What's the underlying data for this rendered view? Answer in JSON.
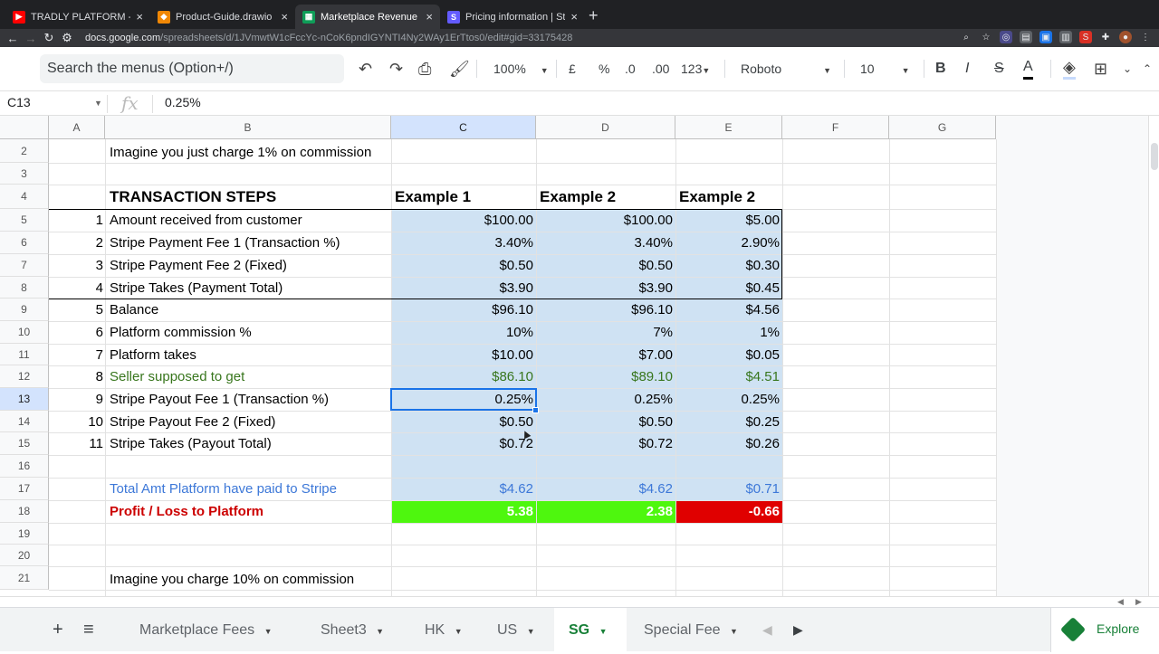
{
  "browser": {
    "tabs": [
      {
        "label": "TRADLY PLATFORM - YouTube",
        "icon": "youtube-icon",
        "color": "#ff0000"
      },
      {
        "label": "Product-Guide.drawio - diagra",
        "icon": "drawio-icon",
        "color": "#f08705"
      },
      {
        "label": "Marketplace Revenue Model C",
        "icon": "sheets-icon",
        "color": "#0f9d58",
        "active": true
      },
      {
        "label": "Pricing information | Stripe Con",
        "icon": "stripe-icon",
        "color": "#635bff"
      }
    ],
    "url_host": "docs.google.com",
    "url_path": "/spreadsheets/d/1JVmwtW1cFccYc-nCoK6pndIGYNTI4Ny2WAy1ErTtos0/edit#gid=33175428"
  },
  "toolbar": {
    "search_placeholder": "Search the menus (Option+/)",
    "zoom": "100%",
    "currency": "£",
    "percent": "%",
    "dec_decrease": ".0",
    "dec_increase": ".00",
    "number_format": "123",
    "font": "Roboto",
    "font_size": "10",
    "bold": "B",
    "italic": "I",
    "strike": "S",
    "text_color": "A"
  },
  "formula_bar": {
    "cell_ref": "C13",
    "fx": "fx",
    "value": "0.25%"
  },
  "columns": [
    "A",
    "B",
    "C",
    "D",
    "E",
    "F",
    "G"
  ],
  "rows": [
    "2",
    "3",
    "4",
    "5",
    "6",
    "7",
    "8",
    "9",
    "10",
    "11",
    "12",
    "13",
    "14",
    "15",
    "16",
    "17",
    "18",
    "19",
    "20",
    "21"
  ],
  "sheet": {
    "r2_text": "Imagine you just charge 1% on commission",
    "r4_title": "TRANSACTION STEPS",
    "r4_c": "Example 1",
    "r4_d": "Example 2",
    "r4_e": "Example 2",
    "steps": [
      {
        "n": "1",
        "label": "Amount received from customer",
        "c": "$100.00",
        "d": "$100.00",
        "e": "$5.00"
      },
      {
        "n": "2",
        "label": "Stripe Payment Fee 1 (Transaction %)",
        "c": "3.40%",
        "d": "3.40%",
        "e": "2.90%"
      },
      {
        "n": "3",
        "label": "Stripe Payment Fee 2 (Fixed)",
        "c": "$0.50",
        "d": "$0.50",
        "e": "$0.30"
      },
      {
        "n": "4",
        "label": "Stripe Takes (Payment Total)",
        "c": "$3.90",
        "d": "$3.90",
        "e": "$0.45"
      },
      {
        "n": "5",
        "label": "Balance",
        "c": "$96.10",
        "d": "$96.10",
        "e": "$4.56"
      },
      {
        "n": "6",
        "label": "Platform commission %",
        "c": "10%",
        "d": "7%",
        "e": "1%"
      },
      {
        "n": "7",
        "label": "Platform takes",
        "c": "$10.00",
        "d": "$7.00",
        "e": "$0.05"
      },
      {
        "n": "8",
        "label": "Seller supposed to get",
        "c": "$86.10",
        "d": "$89.10",
        "e": "$4.51"
      },
      {
        "n": "9",
        "label": "Stripe Payout Fee 1 (Transaction %)",
        "c": "0.25%",
        "d": "0.25%",
        "e": "0.25%"
      },
      {
        "n": "10",
        "label": "Stripe Payout Fee 2 (Fixed)",
        "c": "$0.50",
        "d": "$0.50",
        "e": "$0.25"
      },
      {
        "n": "11",
        "label": "Stripe Takes (Payout Total)",
        "c": "$0.72",
        "d": "$0.72",
        "e": "$0.26"
      }
    ],
    "r17_label": "Total Amt Platform have paid to Stripe",
    "r17_c": "$4.62",
    "r17_d": "$4.62",
    "r17_e": "$0.71",
    "r18_label": "Profit / Loss to Platform",
    "r18_c": "5.38",
    "r18_d": "2.38",
    "r18_e": "-0.66",
    "r21_text": "Imagine you charge 10% on commission"
  },
  "colors": {
    "band_blue": "#cfe2f3",
    "profit_green": "#4ef70e",
    "loss_red": "#e00000",
    "green_text": "#38761d",
    "blue_text": "#3d78d8",
    "red_text": "#cc0000"
  },
  "sheet_tabs": [
    "Marketplace Fees",
    "Sheet3",
    "HK",
    "US",
    "SG",
    "Special Fee"
  ],
  "active_sheet": "SG",
  "explore_label": "Explore"
}
